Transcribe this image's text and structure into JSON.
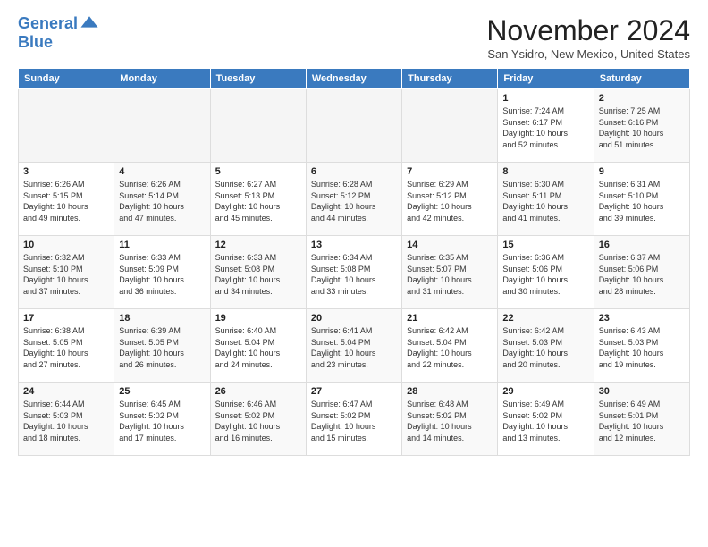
{
  "header": {
    "logo_line1": "General",
    "logo_line2": "Blue",
    "month_title": "November 2024",
    "location": "San Ysidro, New Mexico, United States"
  },
  "weekdays": [
    "Sunday",
    "Monday",
    "Tuesday",
    "Wednesday",
    "Thursday",
    "Friday",
    "Saturday"
  ],
  "weeks": [
    [
      {
        "day": "",
        "info": "",
        "shade": "empty"
      },
      {
        "day": "",
        "info": "",
        "shade": "empty"
      },
      {
        "day": "",
        "info": "",
        "shade": "empty"
      },
      {
        "day": "",
        "info": "",
        "shade": "empty"
      },
      {
        "day": "",
        "info": "",
        "shade": "empty"
      },
      {
        "day": "1",
        "info": "Sunrise: 7:24 AM\nSunset: 6:17 PM\nDaylight: 10 hours\nand 52 minutes.",
        "shade": ""
      },
      {
        "day": "2",
        "info": "Sunrise: 7:25 AM\nSunset: 6:16 PM\nDaylight: 10 hours\nand 51 minutes.",
        "shade": "shaded"
      }
    ],
    [
      {
        "day": "3",
        "info": "Sunrise: 6:26 AM\nSunset: 5:15 PM\nDaylight: 10 hours\nand 49 minutes.",
        "shade": ""
      },
      {
        "day": "4",
        "info": "Sunrise: 6:26 AM\nSunset: 5:14 PM\nDaylight: 10 hours\nand 47 minutes.",
        "shade": "shaded"
      },
      {
        "day": "5",
        "info": "Sunrise: 6:27 AM\nSunset: 5:13 PM\nDaylight: 10 hours\nand 45 minutes.",
        "shade": ""
      },
      {
        "day": "6",
        "info": "Sunrise: 6:28 AM\nSunset: 5:12 PM\nDaylight: 10 hours\nand 44 minutes.",
        "shade": "shaded"
      },
      {
        "day": "7",
        "info": "Sunrise: 6:29 AM\nSunset: 5:12 PM\nDaylight: 10 hours\nand 42 minutes.",
        "shade": ""
      },
      {
        "day": "8",
        "info": "Sunrise: 6:30 AM\nSunset: 5:11 PM\nDaylight: 10 hours\nand 41 minutes.",
        "shade": "shaded"
      },
      {
        "day": "9",
        "info": "Sunrise: 6:31 AM\nSunset: 5:10 PM\nDaylight: 10 hours\nand 39 minutes.",
        "shade": ""
      }
    ],
    [
      {
        "day": "10",
        "info": "Sunrise: 6:32 AM\nSunset: 5:10 PM\nDaylight: 10 hours\nand 37 minutes.",
        "shade": "shaded"
      },
      {
        "day": "11",
        "info": "Sunrise: 6:33 AM\nSunset: 5:09 PM\nDaylight: 10 hours\nand 36 minutes.",
        "shade": ""
      },
      {
        "day": "12",
        "info": "Sunrise: 6:33 AM\nSunset: 5:08 PM\nDaylight: 10 hours\nand 34 minutes.",
        "shade": "shaded"
      },
      {
        "day": "13",
        "info": "Sunrise: 6:34 AM\nSunset: 5:08 PM\nDaylight: 10 hours\nand 33 minutes.",
        "shade": ""
      },
      {
        "day": "14",
        "info": "Sunrise: 6:35 AM\nSunset: 5:07 PM\nDaylight: 10 hours\nand 31 minutes.",
        "shade": "shaded"
      },
      {
        "day": "15",
        "info": "Sunrise: 6:36 AM\nSunset: 5:06 PM\nDaylight: 10 hours\nand 30 minutes.",
        "shade": ""
      },
      {
        "day": "16",
        "info": "Sunrise: 6:37 AM\nSunset: 5:06 PM\nDaylight: 10 hours\nand 28 minutes.",
        "shade": "shaded"
      }
    ],
    [
      {
        "day": "17",
        "info": "Sunrise: 6:38 AM\nSunset: 5:05 PM\nDaylight: 10 hours\nand 27 minutes.",
        "shade": ""
      },
      {
        "day": "18",
        "info": "Sunrise: 6:39 AM\nSunset: 5:05 PM\nDaylight: 10 hours\nand 26 minutes.",
        "shade": "shaded"
      },
      {
        "day": "19",
        "info": "Sunrise: 6:40 AM\nSunset: 5:04 PM\nDaylight: 10 hours\nand 24 minutes.",
        "shade": ""
      },
      {
        "day": "20",
        "info": "Sunrise: 6:41 AM\nSunset: 5:04 PM\nDaylight: 10 hours\nand 23 minutes.",
        "shade": "shaded"
      },
      {
        "day": "21",
        "info": "Sunrise: 6:42 AM\nSunset: 5:04 PM\nDaylight: 10 hours\nand 22 minutes.",
        "shade": ""
      },
      {
        "day": "22",
        "info": "Sunrise: 6:42 AM\nSunset: 5:03 PM\nDaylight: 10 hours\nand 20 minutes.",
        "shade": "shaded"
      },
      {
        "day": "23",
        "info": "Sunrise: 6:43 AM\nSunset: 5:03 PM\nDaylight: 10 hours\nand 19 minutes.",
        "shade": ""
      }
    ],
    [
      {
        "day": "24",
        "info": "Sunrise: 6:44 AM\nSunset: 5:03 PM\nDaylight: 10 hours\nand 18 minutes.",
        "shade": "shaded"
      },
      {
        "day": "25",
        "info": "Sunrise: 6:45 AM\nSunset: 5:02 PM\nDaylight: 10 hours\nand 17 minutes.",
        "shade": ""
      },
      {
        "day": "26",
        "info": "Sunrise: 6:46 AM\nSunset: 5:02 PM\nDaylight: 10 hours\nand 16 minutes.",
        "shade": "shaded"
      },
      {
        "day": "27",
        "info": "Sunrise: 6:47 AM\nSunset: 5:02 PM\nDaylight: 10 hours\nand 15 minutes.",
        "shade": ""
      },
      {
        "day": "28",
        "info": "Sunrise: 6:48 AM\nSunset: 5:02 PM\nDaylight: 10 hours\nand 14 minutes.",
        "shade": "shaded"
      },
      {
        "day": "29",
        "info": "Sunrise: 6:49 AM\nSunset: 5:02 PM\nDaylight: 10 hours\nand 13 minutes.",
        "shade": ""
      },
      {
        "day": "30",
        "info": "Sunrise: 6:49 AM\nSunset: 5:01 PM\nDaylight: 10 hours\nand 12 minutes.",
        "shade": "shaded"
      }
    ]
  ]
}
